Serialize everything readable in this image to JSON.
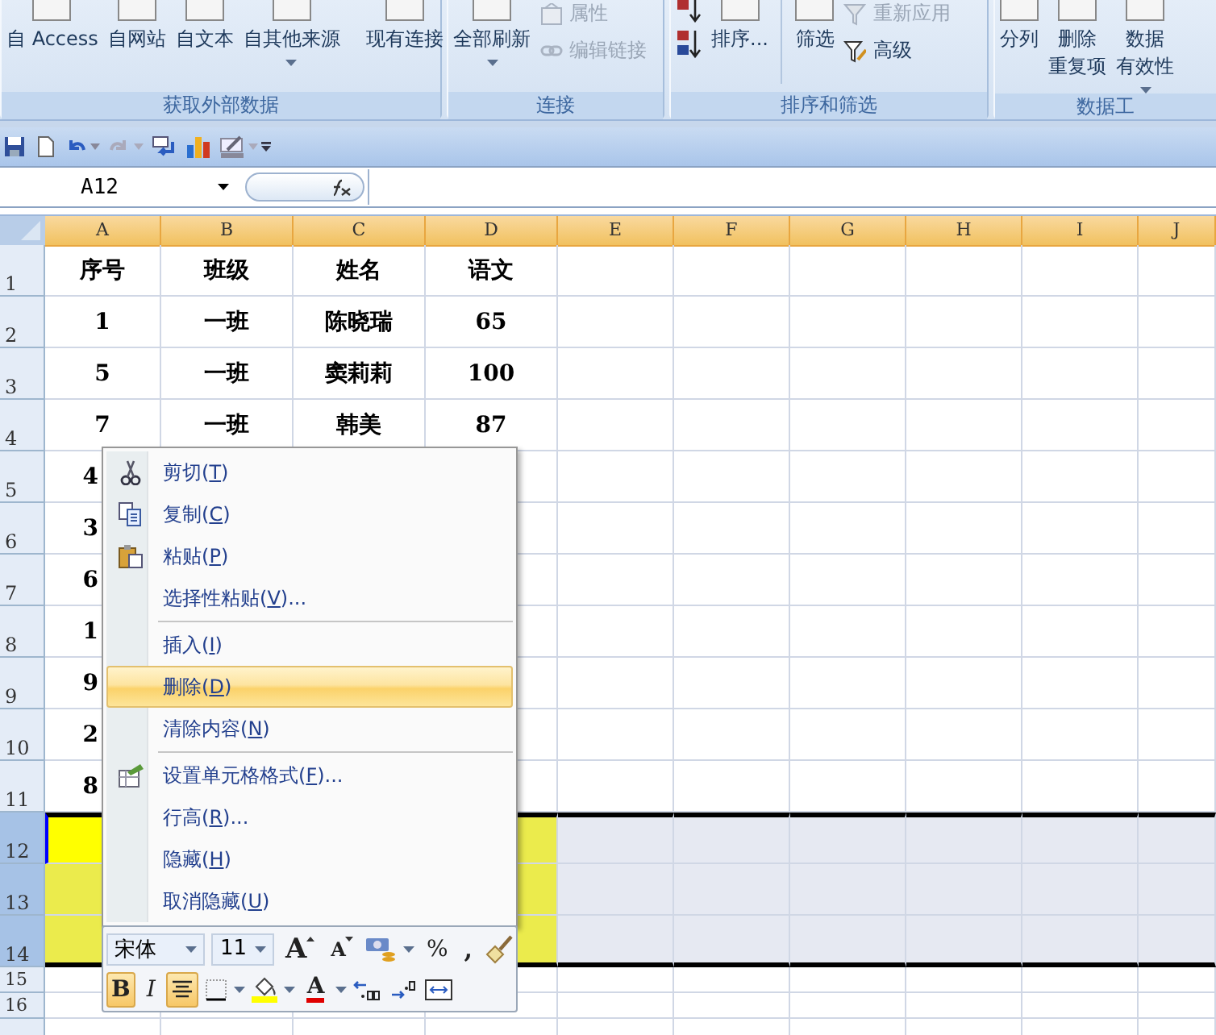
{
  "ribbon": {
    "groups": [
      {
        "label": "获取外部数据",
        "buttons": [
          {
            "kind": "large",
            "lines": [
              "自 Access"
            ],
            "dropdown": false
          },
          {
            "kind": "large",
            "lines": [
              "自网站"
            ],
            "dropdown": false
          },
          {
            "kind": "large",
            "lines": [
              "自文本"
            ],
            "dropdown": false
          },
          {
            "kind": "large",
            "lines": [
              "自其他来源"
            ],
            "dropdown": true
          },
          {
            "kind": "divider"
          },
          {
            "kind": "large",
            "lines": [
              "现有连接"
            ],
            "dropdown": false
          }
        ]
      },
      {
        "label": "连接",
        "buttons": [
          {
            "kind": "large",
            "lines": [
              "全部刷新"
            ],
            "dropdown": true
          },
          {
            "kind": "small",
            "items": [
              {
                "label": "属性",
                "disabled": true
              },
              {
                "label": "编辑链接",
                "disabled": true
              }
            ]
          }
        ]
      },
      {
        "label": "排序和筛选",
        "buttons": [
          {
            "kind": "sort"
          },
          {
            "kind": "large",
            "lines": [
              "排序..."
            ],
            "dropdown": false
          },
          {
            "kind": "divider"
          },
          {
            "kind": "large",
            "lines": [
              "筛选"
            ],
            "dropdown": false
          },
          {
            "kind": "small",
            "items": [
              {
                "label": "重新应用",
                "disabled": true
              },
              {
                "label": "高级",
                "disabled": false
              }
            ]
          }
        ]
      },
      {
        "label": "数据工",
        "buttons": [
          {
            "kind": "large",
            "lines": [
              "分列"
            ],
            "dropdown": false
          },
          {
            "kind": "large",
            "lines": [
              "删除",
              "重复项"
            ],
            "dropdown": false
          },
          {
            "kind": "large",
            "lines": [
              "数据",
              "有效性"
            ],
            "dropdown": true
          }
        ]
      }
    ]
  },
  "name_box": "A12",
  "columns": [
    "A",
    "B",
    "C",
    "D",
    "E",
    "F",
    "G",
    "H",
    "I",
    "J"
  ],
  "rows": [
    {
      "header": "1",
      "selected": false,
      "cells": [
        "序号",
        "班级",
        "姓名",
        "语文"
      ]
    },
    {
      "header": "2",
      "selected": false,
      "cells": [
        "1",
        "一班",
        "陈晓瑞",
        "65"
      ]
    },
    {
      "header": "3",
      "selected": false,
      "cells": [
        "5",
        "一班",
        "窦莉莉",
        "100"
      ]
    },
    {
      "header": "4",
      "selected": false,
      "cells": [
        "7",
        "一班",
        "韩美",
        "87"
      ]
    },
    {
      "header": "5",
      "selected": false,
      "kind": "partial",
      "cells": [
        "4"
      ]
    },
    {
      "header": "6",
      "selected": false,
      "kind": "partial",
      "cells": [
        "3"
      ]
    },
    {
      "header": "7",
      "selected": false,
      "kind": "partial",
      "cells": [
        "6"
      ]
    },
    {
      "header": "8",
      "selected": false,
      "kind": "partial",
      "cells": [
        "1"
      ]
    },
    {
      "header": "9",
      "selected": false,
      "kind": "partial",
      "cells": [
        "9"
      ]
    },
    {
      "header": "10",
      "selected": false,
      "kind": "partial",
      "cells": [
        "2"
      ]
    },
    {
      "header": "11",
      "selected": false,
      "kind": "partial",
      "cells": [
        "8"
      ]
    },
    {
      "header": "12",
      "selected": true,
      "active": true
    },
    {
      "header": "13",
      "selected": true,
      "active": false
    },
    {
      "header": "14",
      "selected": true,
      "active": false
    },
    {
      "header": "15",
      "selected": false,
      "kind": "short"
    },
    {
      "header": "16",
      "selected": false,
      "kind": "short"
    }
  ],
  "context_menu": {
    "items": [
      {
        "kind": "item",
        "label": "剪切(T)",
        "selected": false
      },
      {
        "kind": "item",
        "label": "复制(C)",
        "selected": false
      },
      {
        "kind": "item",
        "label": "粘贴(P)",
        "selected": false
      },
      {
        "kind": "item",
        "label": "选择性粘贴(V)...",
        "selected": false
      },
      {
        "kind": "separator"
      },
      {
        "kind": "item",
        "label": "插入(I)",
        "selected": false
      },
      {
        "kind": "item",
        "label": "删除(D)",
        "selected": true
      },
      {
        "kind": "item",
        "label": "清除内容(N)",
        "selected": false
      },
      {
        "kind": "separator"
      },
      {
        "kind": "item",
        "label": "设置单元格格式(F)...",
        "selected": false
      },
      {
        "kind": "item",
        "label": "行高(R)...",
        "selected": false
      },
      {
        "kind": "item",
        "label": "隐藏(H)",
        "selected": false
      },
      {
        "kind": "item",
        "label": "取消隐藏(U)",
        "selected": false
      }
    ]
  },
  "mini_toolbar": {
    "font": "宋体",
    "size": "11",
    "grow_font": "A",
    "shrink_font": "A",
    "percent": "%",
    "comma": ",",
    "bold": {
      "label": "B",
      "on": true
    },
    "italic": {
      "label": "I",
      "on": false
    },
    "center": {
      "on": true
    },
    "font_color": "A"
  }
}
